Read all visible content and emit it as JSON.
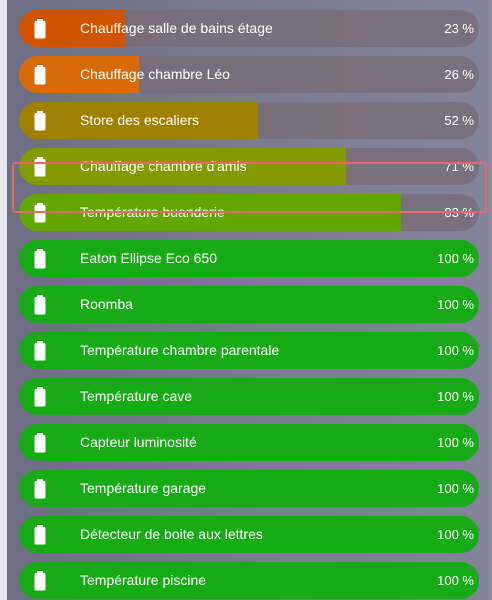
{
  "colors": {
    "low": "#d35400",
    "low2": "#d86a08",
    "mid": "#a08000",
    "mid_high": "#859a00",
    "high": "#63a600",
    "full": "#18ab18",
    "track": "#7a6c76",
    "highlight_border": "#e26a6c"
  },
  "icon": "battery-icon",
  "batteries": [
    {
      "name": "Chauffage salle de bains étage",
      "level": 23,
      "level_label": "23 %",
      "color": "#d35400"
    },
    {
      "name": "Chauffage chambre Léo",
      "level": 26,
      "level_label": "26 %",
      "color": "#d86a08"
    },
    {
      "name": "Store des escaliers",
      "level": 52,
      "level_label": "52 %",
      "color": "#a08000"
    },
    {
      "name": "Chauffage chambre d'amis",
      "level": 71,
      "level_label": "71 %",
      "color": "#859a00"
    },
    {
      "name": "Température buanderie",
      "level": 83,
      "level_label": "83 %",
      "color": "#63a600",
      "highlighted": true
    },
    {
      "name": "Eaton Ellipse Eco 650",
      "level": 100,
      "level_label": "100 %",
      "color": "#18ab18"
    },
    {
      "name": "Roomba",
      "level": 100,
      "level_label": "100 %",
      "color": "#18ab18"
    },
    {
      "name": "Température chambre parentale",
      "level": 100,
      "level_label": "100 %",
      "color": "#18ab18"
    },
    {
      "name": "Température cave",
      "level": 100,
      "level_label": "100 %",
      "color": "#18ab18"
    },
    {
      "name": "Capteur luminosité",
      "level": 100,
      "level_label": "100 %",
      "color": "#18ab18"
    },
    {
      "name": "Température garage",
      "level": 100,
      "level_label": "100 %",
      "color": "#18ab18"
    },
    {
      "name": "Détecteur de boite aux lettres",
      "level": 100,
      "level_label": "100 %",
      "color": "#18ab18"
    },
    {
      "name": "Température piscine",
      "level": 100,
      "level_label": "100 %",
      "color": "#18ab18"
    }
  ]
}
